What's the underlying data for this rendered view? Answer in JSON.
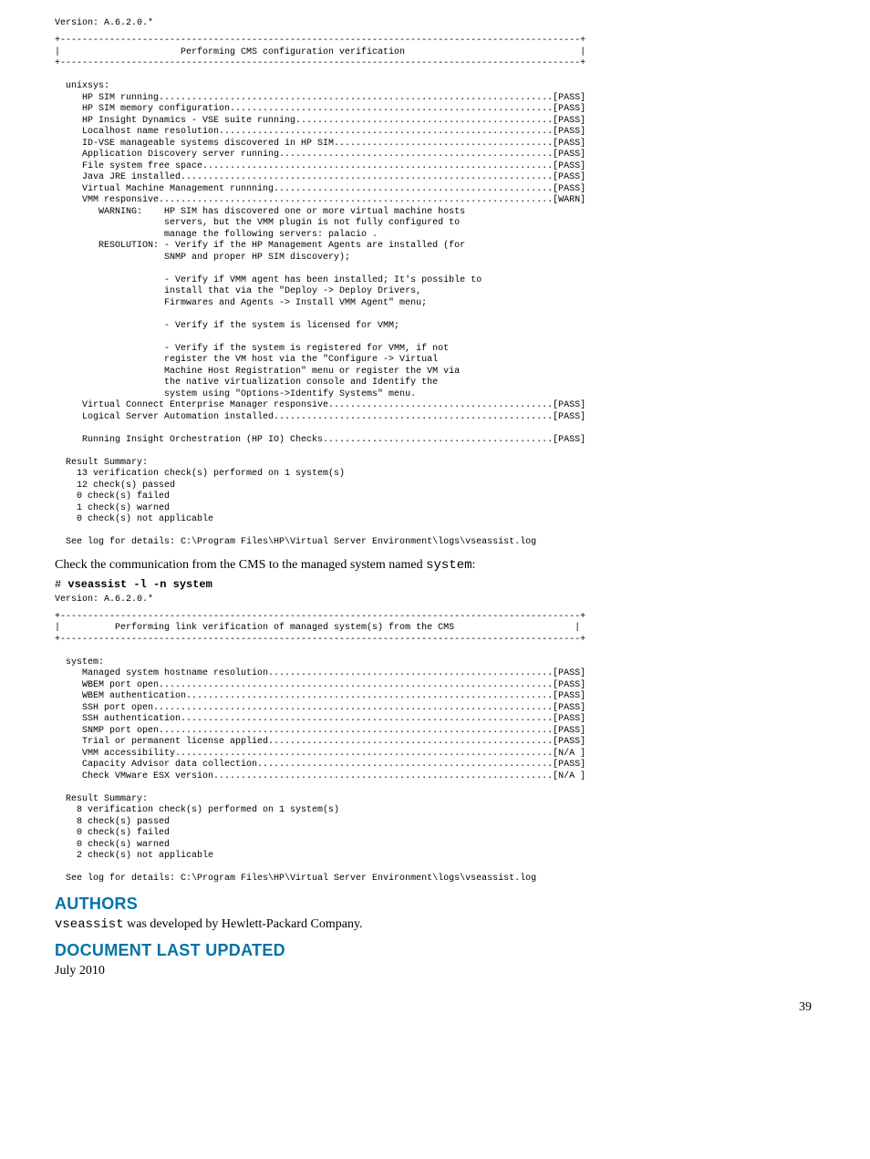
{
  "version_line_1": "Version: A.6.2.0.*",
  "terminal_block_1": "+-----------------------------------------------------------------------------------------------+\n|                      Performing CMS configuration verification                                |\n+-----------------------------------------------------------------------------------------------+\n\n  unixsys:\n     HP SIM running........................................................................[PASS]\n     HP SIM memory configuration...........................................................[PASS]\n     HP Insight Dynamics - VSE suite running...............................................[PASS]\n     Localhost name resolution.............................................................[PASS]\n     ID-VSE manageable systems discovered in HP SIM........................................[PASS]\n     Application Discovery server running..................................................[PASS]\n     File system free space................................................................[PASS]\n     Java JRE installed....................................................................[PASS]\n     Virtual Machine Management runnning...................................................[PASS]\n     VMM responsive........................................................................[WARN]\n        WARNING:    HP SIM has discovered one or more virtual machine hosts\n                    servers, but the VMM plugin is not fully configured to\n                    manage the following servers: palacio .\n        RESOLUTION: - Verify if the HP Management Agents are installed (for\n                    SNMP and proper HP SIM discovery);\n\n                    - Verify if VMM agent has been installed; It's possible to\n                    install that via the \"Deploy -> Deploy Drivers,\n                    Firmwares and Agents -> Install VMM Agent\" menu;\n\n                    - Verify if the system is licensed for VMM;\n\n                    - Verify if the system is registered for VMM, if not\n                    register the VM host via the \"Configure -> Virtual\n                    Machine Host Registration\" menu or register the VM via\n                    the native virtualization console and Identify the\n                    system using \"Options->Identify Systems\" menu.\n     Virtual Connect Enterprise Manager responsive.........................................[PASS]\n     Logical Server Automation installed...................................................[PASS]\n\n     Running Insight Orchestration (HP IO) Checks..........................................[PASS]\n\n  Result Summary:\n    13 verification check(s) performed on 1 system(s)\n    12 check(s) passed\n    0 check(s) failed\n    1 check(s) warned\n    0 check(s) not applicable\n\n  See log for details: C:\\Program Files\\HP\\Virtual Server Environment\\logs\\vseassist.log",
  "body_text_1_pre": "Check the communication from the CMS to the managed system named ",
  "body_text_1_code": "system",
  "body_text_1_post": ":",
  "command_prompt": "# ",
  "command_text": "vseassist -l -n system",
  "version_line_2": "Version: A.6.2.0.*",
  "terminal_block_2": "+-----------------------------------------------------------------------------------------------+\n|          Performing link verification of managed system(s) from the CMS                      |\n+-----------------------------------------------------------------------------------------------+\n\n  system:\n     Managed system hostname resolution....................................................[PASS]\n     WBEM port open........................................................................[PASS]\n     WBEM authentication...................................................................[PASS]\n     SSH port open.........................................................................[PASS]\n     SSH authentication....................................................................[PASS]\n     SNMP port open........................................................................[PASS]\n     Trial or permanent license applied....................................................[PASS]\n     VMM accessibility.....................................................................[N/A ]\n     Capacity Advisor data collection......................................................[PASS]\n     Check VMware ESX version..............................................................[N/A ]\n\n  Result Summary:\n    8 verification check(s) performed on 1 system(s)\n    8 check(s) passed\n    0 check(s) failed\n    0 check(s) warned\n    2 check(s) not applicable\n\n  See log for details: C:\\Program Files\\HP\\Virtual Server Environment\\logs\\vseassist.log",
  "authors_heading": "AUTHORS",
  "authors_code": "vseassist",
  "authors_text": " was developed by Hewlett-Packard Company.",
  "updated_heading": "DOCUMENT LAST UPDATED",
  "updated_text": "July 2010",
  "page_number": "39"
}
